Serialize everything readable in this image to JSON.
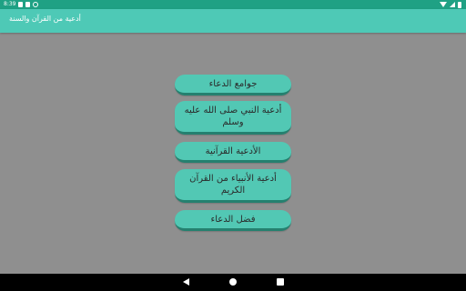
{
  "status_bar": {
    "time": "8:39"
  },
  "app_bar": {
    "title": "أدعية من القرآن والسنة"
  },
  "menu": [
    "جوامع الدعاء",
    "أدعية النبي صلى الله عليه وسلم",
    "الأدعية القرآنية",
    "أدعية الأنبياء من القرآن الكريم",
    "فضل الدعاء"
  ],
  "colors": {
    "status_bar": "#1fa184",
    "app_bar": "#4ec9b6",
    "button": "#52c8b4",
    "button_shadow": "#25806f",
    "background": "#8f8f8f"
  }
}
